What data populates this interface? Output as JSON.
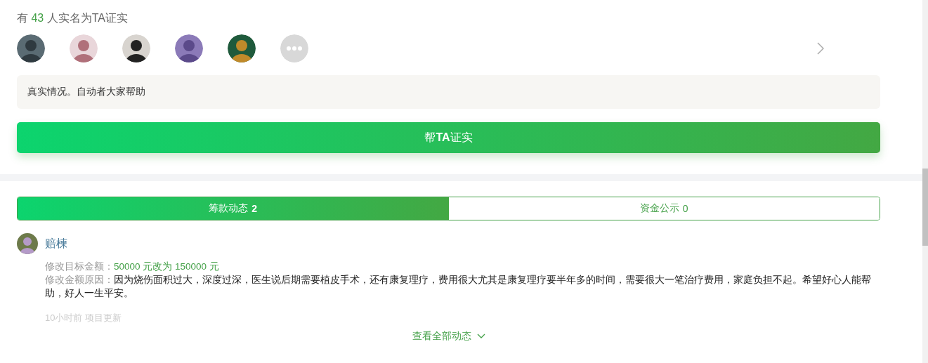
{
  "verify": {
    "heading": "有 **43** 人实名为TA证实",
    "avatars": [
      {
        "kind": "photo"
      },
      {
        "kind": "photo"
      },
      {
        "kind": "photo"
      },
      {
        "kind": "photo"
      },
      {
        "kind": "photo"
      },
      {
        "kind": "more"
      }
    ],
    "comment": "真实情况。自动者大家帮助",
    "button": "帮**TA**证实"
  },
  "tabs": [
    {
      "label": "筹款动态",
      "count": "2",
      "selected": true
    },
    {
      "label": "资金公示",
      "count": "0",
      "selected": false
    }
  ],
  "updates": [
    {
      "user": "赔楝",
      "fields": [
        {
          "label": "修改目标金额：",
          "value": "50000 元改为 150000 元",
          "kind": "amount"
        },
        {
          "label": "修改金额原因：",
          "value": "因为烧伤面积过大，深度过深，医生说后期需要植皮手术，还有康复理疗，费用很大尤其是康复理疗要半年多的时间，需要很大一笔治疗费用，家庭负担不起。希望好心人能帮助，好人一生平安。",
          "kind": "text"
        }
      ],
      "time": "10小时前 项目更新"
    }
  ],
  "more_link": "查看全部动态"
}
